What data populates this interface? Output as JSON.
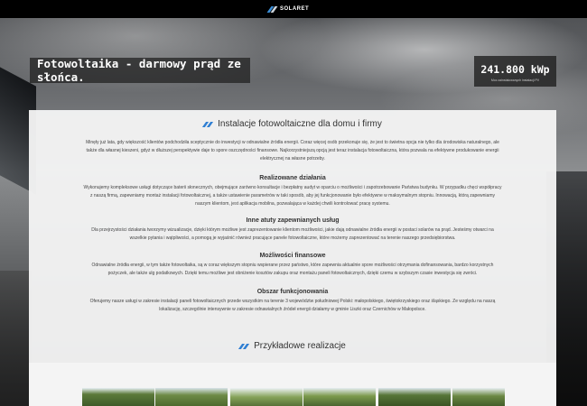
{
  "header": {
    "logo_text": "SOLARET"
  },
  "hero": {
    "title": "Fotowoltaika - darmowy prąd ze słońca.",
    "stat_value": "241.800 kWp",
    "stat_caption": "Moc zainstalowanych instalacji PV"
  },
  "main": {
    "heading": "Instalacje fotowoltaiczne dla domu i firmy",
    "intro": "Minęły już lata, gdy większość klientów podchodziła sceptycznie do inwestycji w odnawialne źródła energii. Coraz więcej osób przekonuje się, że jest to świetna opcja nie tylko dla środowiska naturalnego, ale także dla własnej kieszeni, gdyż w dłuższej perspektywie daje to spore oszczędności finansowe. Najkorzystniejszą opcją jest teraz instalacja fotowoltaiczna, która pozwala na efektywne produkowanie energii elektrycznej na własne potrzeby.",
    "sections": [
      {
        "title": "Realizowane działania",
        "text": "Wykonujemy kompleksowe usługi dotyczące baterii słonecznych, obejmujące zarówno konsultacje i bezpłatny audyt w oparciu o możliwości i zapotrzebowanie Państwa budynku. W przypadku chęci współpracy z naszą firmą, zapewniamy montaż instalacji fotowoltaicznej, a także ustawienie parametrów w taki sposób, aby jej funkcjonowanie było efektywne w maksymalnym stopniu. Innowacją, którą zapewniamy naszym klientom, jest aplikacja mobilna, pozwalająca w każdej chwili kontrolować pracę systemu."
      },
      {
        "title": "Inne atuty zapewnianych usług",
        "text": "Dla przejrzystości działania tworzymy wizualizacje, dzięki którym możliwe jest zaprezentowanie klientom możliwości, jakie dają odnawialne źródła energii w postaci solarów na prąd. Jesteśmy otwarci na wszelkie pytania i wątpliwości, a pomogą je wyjaśnić również pracujące panele fotowoltaiczne, które możemy zaprezentować na terenie naszego przedsiębiorstwa."
      },
      {
        "title": "Możliwości finansowe",
        "text": "Odnawialne źródła energii, w tym także fotowoltaika, są w coraz większym stopniu wspierane przez państwo, które zapewnia aktualnie spore możliwości otrzymania dofinansowania, bardzo korzystnych pożyczek, ale także ulg podatkowych. Dzięki temu możliwe jest obniżenie kosztów zakupu oraz montażu paneli fotowoltaicznych, dzięki czemu w szybszym czasie inwestycja się zwróci."
      },
      {
        "title": "Obszar funkcjonowania",
        "text": "Oferujemy nasze usługi w zakresie instalacji paneli fotowoltaicznych przede wszystkim na terenie 3 województw południowej Polski: małopolskiego, świętokrzyskiego oraz śląskiego. Ze względu na naszą lokalizację, szczególnie intensywnie w zakresie odnawialnych źródeł energii działamy w gminie Liszki oraz Czernichów w Małopolsce."
      }
    ],
    "examples_heading": "Przykładowe realizacje"
  },
  "colors": {
    "accent": "#2f7fd3",
    "topbar": "#000000",
    "card": "#f4f4f4"
  }
}
